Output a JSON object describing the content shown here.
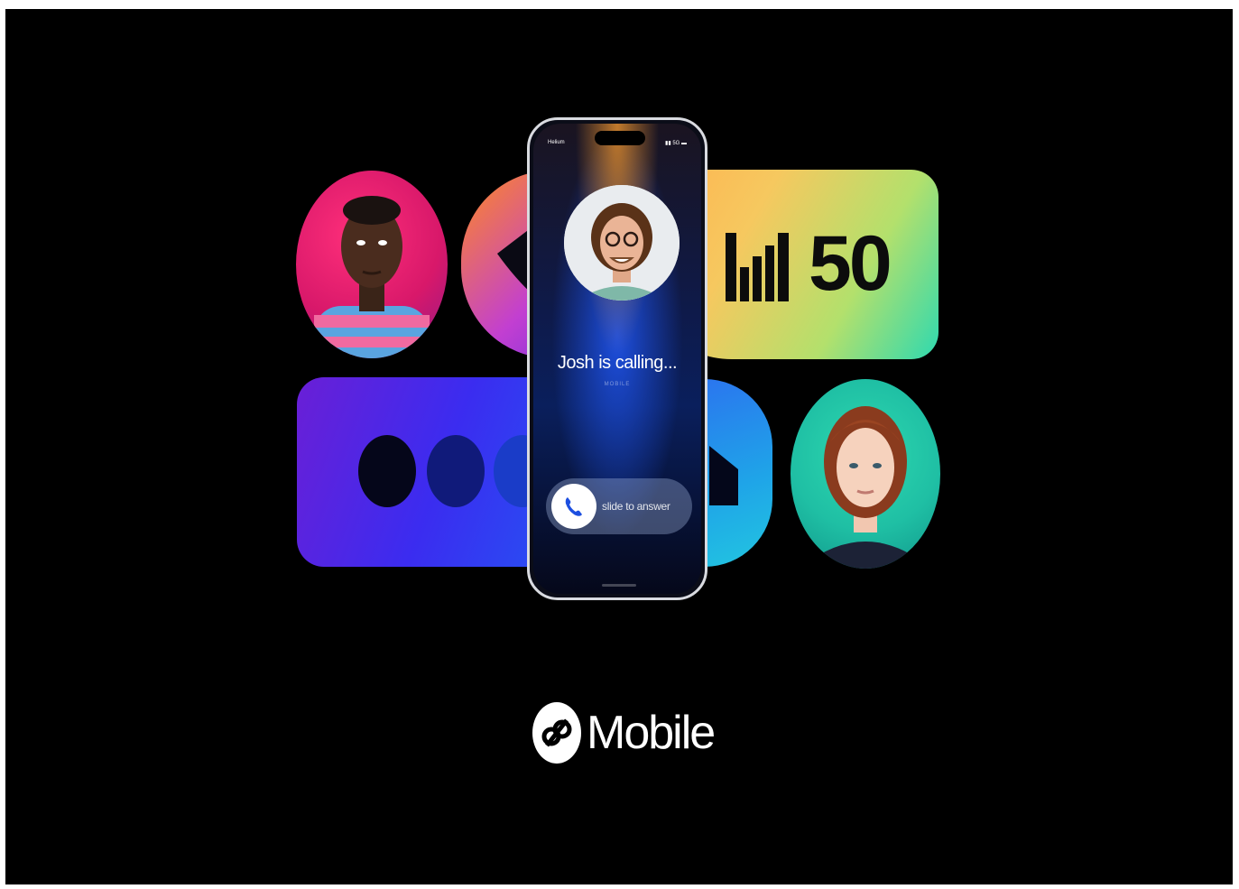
{
  "phone": {
    "carrier": "Helium",
    "network": "5G",
    "caller_status": "Josh is calling...",
    "caller_label": "MOBILE",
    "slide_label": "slide to answer"
  },
  "signal_badge": {
    "value": "50",
    "signal_bars": 5
  },
  "dots_badge": {
    "dot_count": 3
  },
  "brand": {
    "name": "Mobile"
  },
  "colors": {
    "background": "#000000",
    "signal_gradient": [
      "#ffb14e",
      "#2ed9b0"
    ],
    "dots_gradient": [
      "#6a1fd6",
      "#1f5ff5"
    ],
    "accent_blue": "#1d4fe0"
  }
}
